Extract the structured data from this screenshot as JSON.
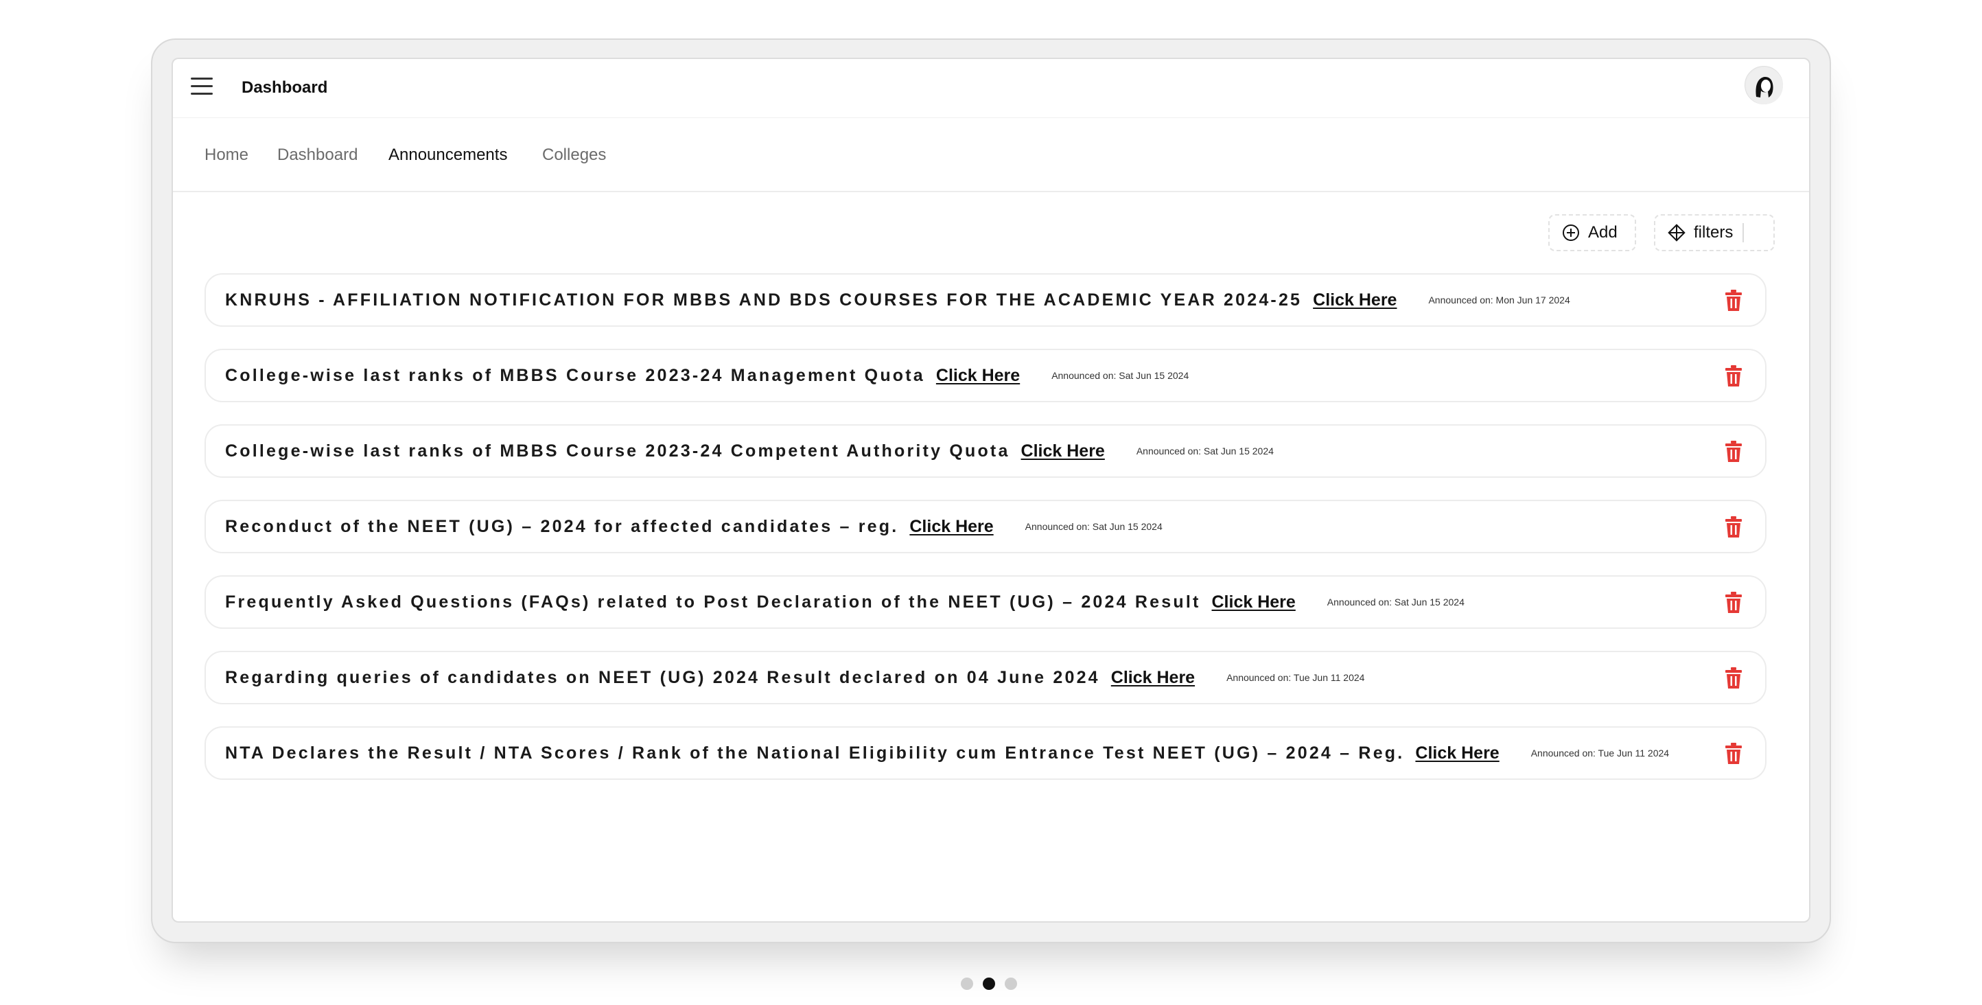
{
  "header": {
    "title": "Dashboard"
  },
  "nav": {
    "tabs": [
      {
        "label": "Home",
        "active": false
      },
      {
        "label": "Dashboard",
        "active": false
      },
      {
        "label": "Announcements",
        "active": true
      },
      {
        "label": "Colleges",
        "active": false
      }
    ]
  },
  "toolbar": {
    "add_label": "Add",
    "filters_label": "filters"
  },
  "announcements": [
    {
      "title": "KNRUHS - AFFILIATION NOTIFICATION FOR MBBS AND BDS COURSES FOR THE ACADEMIC YEAR 2024-25",
      "link": "Click Here",
      "date": "Announced on: Mon Jun 17 2024"
    },
    {
      "title": "College-wise last ranks of MBBS Course 2023-24 Management Quota",
      "link": "Click Here",
      "date": "Announced on: Sat Jun 15 2024"
    },
    {
      "title": "College-wise last ranks of MBBS Course 2023-24 Competent Authority Quota",
      "link": "Click Here",
      "date": "Announced on: Sat Jun 15 2024"
    },
    {
      "title": "Reconduct of the NEET (UG) – 2024 for affected candidates – reg.",
      "link": "Click Here",
      "date": "Announced on: Sat Jun 15 2024"
    },
    {
      "title": "Frequently Asked Questions (FAQs) related to Post Declaration of the NEET (UG) – 2024 Result",
      "link": "Click Here",
      "date": "Announced on: Sat Jun 15 2024"
    },
    {
      "title": "Regarding queries of candidates on NEET (UG) 2024 Result declared on 04 June 2024",
      "link": "Click Here",
      "date": "Announced on: Tue Jun 11 2024"
    },
    {
      "title": "NTA Declares the Result / NTA Scores / Rank of the National Eligibility cum Entrance Test NEET (UG) – 2024 – Reg.",
      "link": "Click Here",
      "date": "Announced on: Tue Jun 11 2024"
    }
  ],
  "carousel": {
    "total_slides": 3,
    "active_slide": 2
  },
  "colors": {
    "delete": "#e53935",
    "text": "#111111"
  },
  "icons": {
    "menu": "menu-icon",
    "avatar": "avatar-icon",
    "add": "plus-circle-icon",
    "filters": "filter-icon",
    "delete": "trash-icon",
    "prev": "chevron-left-icon",
    "next": "chevron-right-icon"
  }
}
